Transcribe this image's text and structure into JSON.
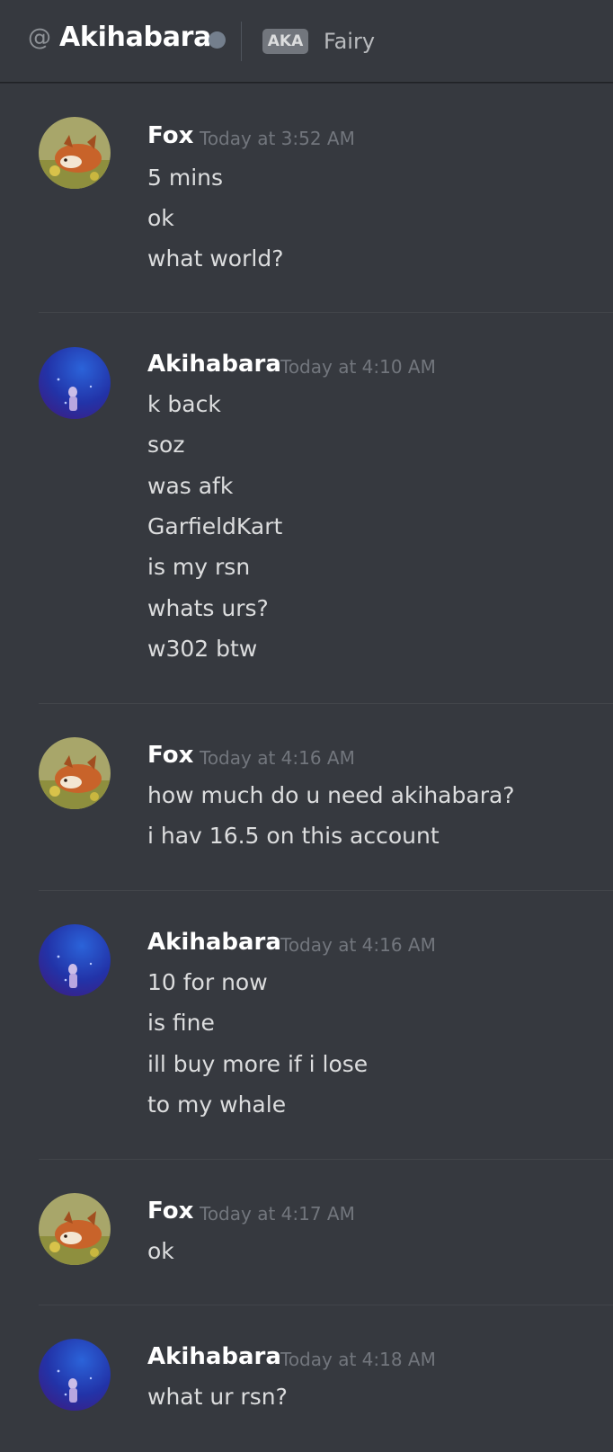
{
  "header": {
    "at_symbol": "@",
    "name": "Akihabara",
    "aka_badge": "AKA",
    "aka_name": "Fairy"
  },
  "messages": [
    {
      "author": "Fox",
      "avatar": "fox-avatar",
      "timestamp": "Today at 3:52 AM",
      "lines": [
        "5 mins",
        "ok",
        "what world?"
      ]
    },
    {
      "author": "Akihabara",
      "avatar": "akihabara-avatar",
      "timestamp": "Today at 4:10 AM",
      "lines": [
        "k back",
        "soz",
        "was afk",
        "GarfieldKart",
        "is my rsn",
        "whats urs?",
        "w302 btw"
      ]
    },
    {
      "author": "Fox",
      "avatar": "fox-avatar",
      "timestamp": "Today at 4:16 AM",
      "lines": [
        "how much do u need akihabara?",
        "i hav 16.5 on this account"
      ]
    },
    {
      "author": "Akihabara",
      "avatar": "akihabara-avatar",
      "timestamp": "Today at 4:16 AM",
      "lines": [
        "10 for now",
        "is fine",
        "ill buy more if i lose",
        "to my whale"
      ]
    },
    {
      "author": "Fox",
      "avatar": "fox-avatar",
      "timestamp": "Today at 4:17 AM",
      "lines": [
        "ok"
      ]
    },
    {
      "author": "Akihabara",
      "avatar": "akihabara-avatar",
      "timestamp": "Today at 4:18 AM",
      "lines": [
        "what ur rsn?"
      ]
    }
  ],
  "colors": {
    "background": "#36393f",
    "username": "#ffffff",
    "message_text": "#dcddde",
    "timestamp": "#72767d",
    "status_offline": "#747f8d"
  }
}
